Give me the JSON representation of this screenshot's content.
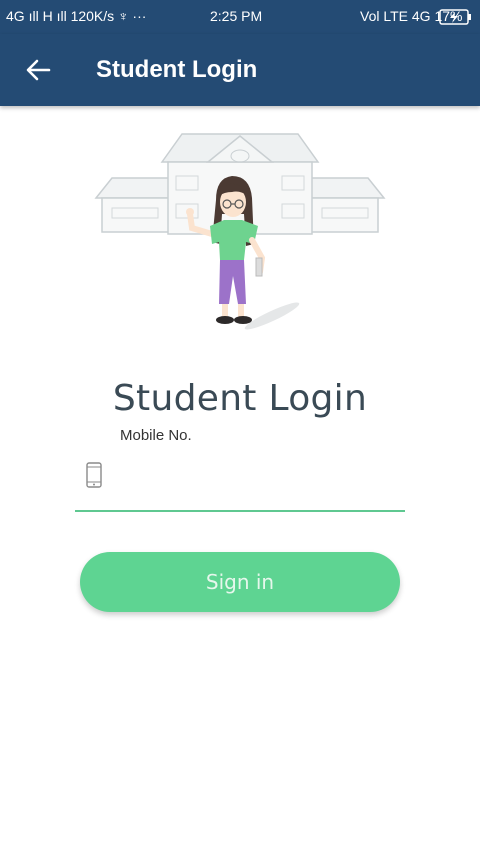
{
  "status_bar": {
    "left": "4G ıll  H ıll  120K/s ♆ ···",
    "time": "2:25 PM",
    "right": "Vol LTE 4G 17%"
  },
  "app_bar": {
    "back_icon": "arrow-left-icon",
    "title": "Student Login"
  },
  "illustration": {
    "subject": "school-building-student-girl"
  },
  "form": {
    "heading": "Student Login",
    "mobile_label": "Mobile No.",
    "mobile_value": "",
    "mobile_icon": "mobile-phone-icon",
    "signin_label": "Sign in"
  },
  "colors": {
    "app_bar": "#244b74",
    "accent": "#5ed492",
    "input_line": "#5fc891"
  }
}
